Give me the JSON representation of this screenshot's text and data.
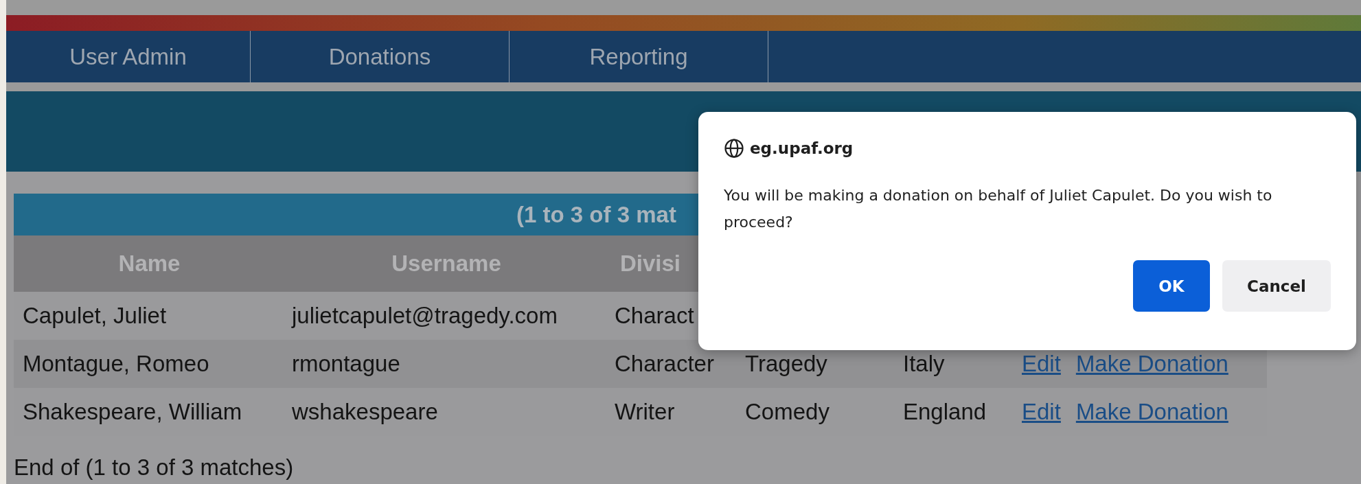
{
  "nav": {
    "tabs": [
      {
        "label": "User Admin",
        "selected": false
      },
      {
        "label": "Donations",
        "selected": false
      },
      {
        "label": "Reporting",
        "selected": false
      }
    ]
  },
  "results": {
    "summary": "(1 to 3 of 3 mat",
    "columns": [
      "Name",
      "Username",
      "Divisi"
    ],
    "rows": [
      {
        "cells": [
          "Capulet, Juliet",
          "julietcapulet@tragedy.com",
          "Charact"
        ],
        "links": []
      },
      {
        "cells": [
          "Montague, Romeo",
          "rmontague",
          "Character",
          "Tragedy",
          "Italy"
        ],
        "links": [
          "Edit",
          "Make Donation"
        ]
      },
      {
        "cells": [
          "Shakespeare, William",
          "wshakespeare",
          "Writer",
          "Comedy",
          "England"
        ],
        "links": [
          "Edit",
          "Make Donation"
        ]
      }
    ],
    "footer": "End of (1 to 3 of 3 matches)"
  },
  "dialog": {
    "site": "eg.upaf.org",
    "message": "You will be making a donation on behalf of Juliet Capulet. Do you wish to proceed?",
    "buttons": [
      {
        "label": "OK",
        "kind": "primary"
      },
      {
        "label": "Cancel",
        "kind": "secondary"
      }
    ]
  }
}
